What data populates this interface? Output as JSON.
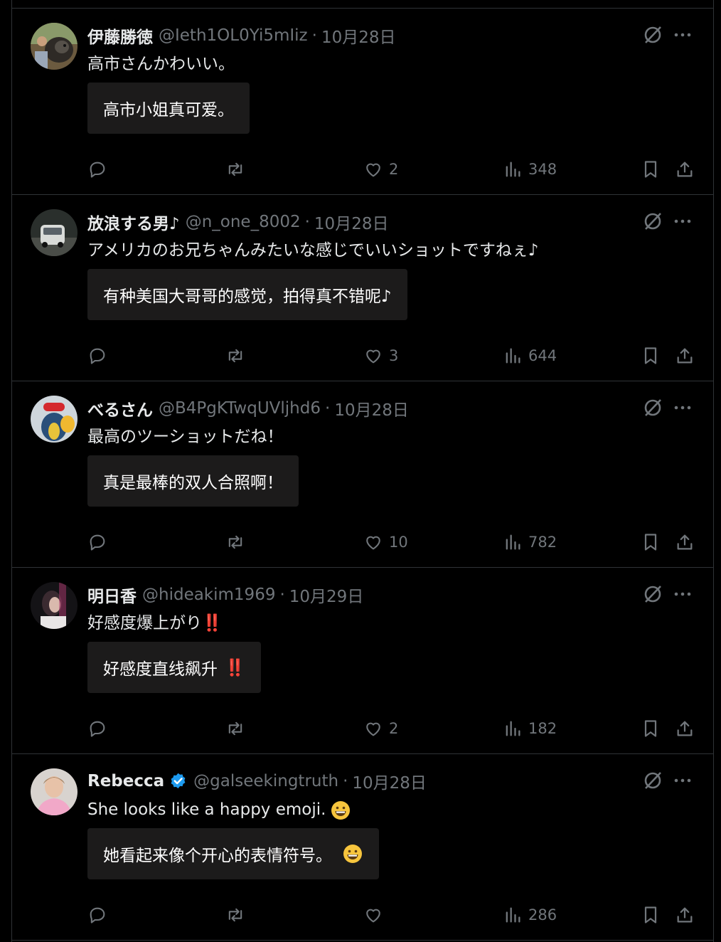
{
  "colors": {
    "background": "#000000",
    "text": "#e7e9ea",
    "muted": "#71767b",
    "divider": "#2f3336",
    "translation_bg": "#1c1b1b",
    "verified": "#1d9bf0",
    "exclaim": "#e0203a"
  },
  "tweets": [
    {
      "name": "伊藤勝徳",
      "handle": "@Ieth1OL0Yi5mIiz",
      "sep": "·",
      "time": "10月28日",
      "text": "高市さんかわいい。",
      "translation": "高市小姐真可爱。",
      "likes": "2",
      "views": "348",
      "avatar_icon": "dog-photo-avatar"
    },
    {
      "name": "放浪する男♪",
      "handle": "@n_one_8002",
      "sep": "·",
      "time": "10月28日",
      "text": "アメリカのお兄ちゃんみたいな感じでいいショットですねぇ♪",
      "translation": "有种美国大哥哥的感觉，拍得真不错呢♪",
      "likes": "3",
      "views": "644",
      "avatar_icon": "car-photo-avatar"
    },
    {
      "name": "べるさん",
      "handle": "@B4PgKTwqUVljhd6",
      "sep": "·",
      "time": "10月28日",
      "text": "最高のツーショットだね！",
      "translation": "真是最棒的双人合照啊！",
      "likes": "10",
      "views": "782",
      "avatar_icon": "plush-toy-avatar"
    },
    {
      "name": "明日香",
      "handle": "@hideakim1969",
      "sep": "·",
      "time": "10月29日",
      "text": "好感度爆上がり",
      "text_emoji": "‼️",
      "translation": "好感度直线飙升",
      "translation_emoji": "‼️",
      "likes": "2",
      "views": "182",
      "avatar_icon": "person-night-avatar"
    },
    {
      "name": "Rebecca",
      "verified": true,
      "handle": "@galseekingtruth",
      "sep": "·",
      "time": "10月28日",
      "text": "She looks like a happy emoji.",
      "text_emoji": "grinning-face-emoji",
      "translation": "她看起来像个开心的表情符号。",
      "translation_emoji": "grinning-face-emoji",
      "likes": "",
      "views": "286",
      "avatar_icon": "person-pink-avatar"
    }
  ],
  "icons": {
    "reply": "reply-icon",
    "retweet": "retweet-icon",
    "like": "heart-icon",
    "views": "views-icon",
    "bookmark": "bookmark-icon",
    "share": "share-icon",
    "grok": "grok-icon",
    "more": "more-icon"
  }
}
